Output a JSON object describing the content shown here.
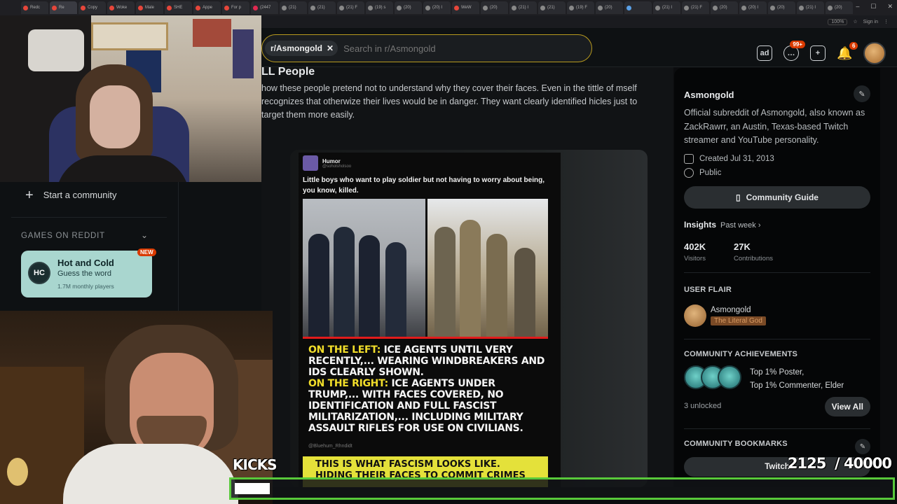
{
  "browser": {
    "tabs": [
      {
        "label": "Redc",
        "color": "#e6463a"
      },
      {
        "label": "Re",
        "color": "#e6463a",
        "active": true
      },
      {
        "label": "Copy",
        "color": "#e6463a"
      },
      {
        "label": "Woke",
        "color": "#e6463a"
      },
      {
        "label": "Male",
        "color": "#e6463a"
      },
      {
        "label": "SHE",
        "color": "#e6463a"
      },
      {
        "label": "Appe",
        "color": "#e6463a"
      },
      {
        "label": "For p",
        "color": "#e6463a"
      },
      {
        "label": "(2447",
        "color": "#e02950"
      },
      {
        "label": "(21)",
        "color": "#888888"
      },
      {
        "label": "(21)",
        "color": "#888888"
      },
      {
        "label": "(21) F",
        "color": "#888888"
      },
      {
        "label": "(19) s",
        "color": "#888888"
      },
      {
        "label": "(20)",
        "color": "#888888"
      },
      {
        "label": "(20) I",
        "color": "#888888"
      },
      {
        "label": "WeW",
        "color": "#e6463a"
      },
      {
        "label": "(20)",
        "color": "#888888"
      },
      {
        "label": "(21) I",
        "color": "#888888"
      },
      {
        "label": "(21)",
        "color": "#888888"
      },
      {
        "label": "(19) F",
        "color": "#888888"
      },
      {
        "label": "(20)",
        "color": "#888888"
      },
      {
        "label": "",
        "color": "#5aa0e6"
      },
      {
        "label": "(21) I",
        "color": "#888888"
      },
      {
        "label": "(21) F",
        "color": "#888888"
      },
      {
        "label": "(20)",
        "color": "#888888"
      },
      {
        "label": "(20) I",
        "color": "#888888"
      },
      {
        "label": "(20)",
        "color": "#888888"
      },
      {
        "label": "(21) I",
        "color": "#888888"
      },
      {
        "label": "(20)",
        "color": "#888888"
      }
    ],
    "zoom": "100%",
    "sign_in": "Sign in"
  },
  "header": {
    "community_chip": "r/Asmongold",
    "search_placeholder": "Search in r/Asmongold",
    "chat_badge": "99+",
    "notif_badge": "6",
    "advertise_icon": "advertise-icon",
    "chat_icon": "chat-icon",
    "create_icon": "plus-icon",
    "bell_icon": "bell-icon"
  },
  "post": {
    "title_visible": "LL People",
    "body": "how these people pretend not to understand why they cover their faces. Even in the tittle of mself recognizes that otherwize their lives would be in danger. They want clearly identified hicles just to target them more easily.",
    "embed": {
      "account_name": "Humor",
      "handle": "@soholsholsoo",
      "caption": "Little boys who want to play soldier but not having to worry about being, you know, killed.",
      "left_label": "ON THE LEFT:",
      "left_text": "ICE AGENTS UNTIL VERY RECENTLY,... WEARING WINDBREAKERS AND IDS CLEARLY SHOWN.",
      "right_label": "ON THE RIGHT:",
      "right_text": "ICE AGENTS UNDER TRUMP,... WITH FACES COVERED, NO IDENTIFICATION AND FULL FASCIST MILITARIZATION,... INCLUDING MILITARY ASSAULT RIFLES FOR USE ON CIVILIANS.",
      "source_handle": "@Bluehum_Rhndidt",
      "yellow_text": "THIS IS WHAT FASCISM LOOKS LIKE. HIDING THEIR FACES TO COMMIT CRIMES"
    }
  },
  "sidebar": {
    "name": "Asmongold",
    "description": "Official subreddit of Asmongold, also known as ZackRawrr, an Austin, Texas-based Twitch streamer and YouTube personality.",
    "created": "Created Jul 31, 2013",
    "visibility": "Public",
    "guide_button": "Community Guide",
    "insights_label": "Insights",
    "insights_period": "Past week ›",
    "visitors_value": "402K",
    "visitors_label": "Visitors",
    "contrib_value": "27K",
    "contrib_label": "Contributions",
    "user_flair_header": "USER FLAIR",
    "flair_user": "Asmongold",
    "flair_tag": "The Literal God",
    "achievements_header": "COMMUNITY ACHIEVEMENTS",
    "achievement_1": "Top 1% Poster,",
    "achievement_2": "Top 1% Commenter, Elder",
    "unlocked": "3 unlocked",
    "view_all": "View All",
    "bookmarks_header": "COMMUNITY BOOKMARKS",
    "bookmark_1": "Twitch"
  },
  "leftnav": {
    "start_community": "Start a community",
    "games_header": "GAMES ON REDDIT",
    "game_title": "Hot and Cold",
    "game_subtitle": "Guess the word",
    "game_players": "1.7M monthly players",
    "game_badge": "NEW",
    "game_logo": "HC"
  },
  "overlay": {
    "kicks_label": "KICKS",
    "kicks_count": "2125  / 40000",
    "kicks_current": 2125,
    "kicks_goal": 40000,
    "bar_color": "#58c93a"
  }
}
